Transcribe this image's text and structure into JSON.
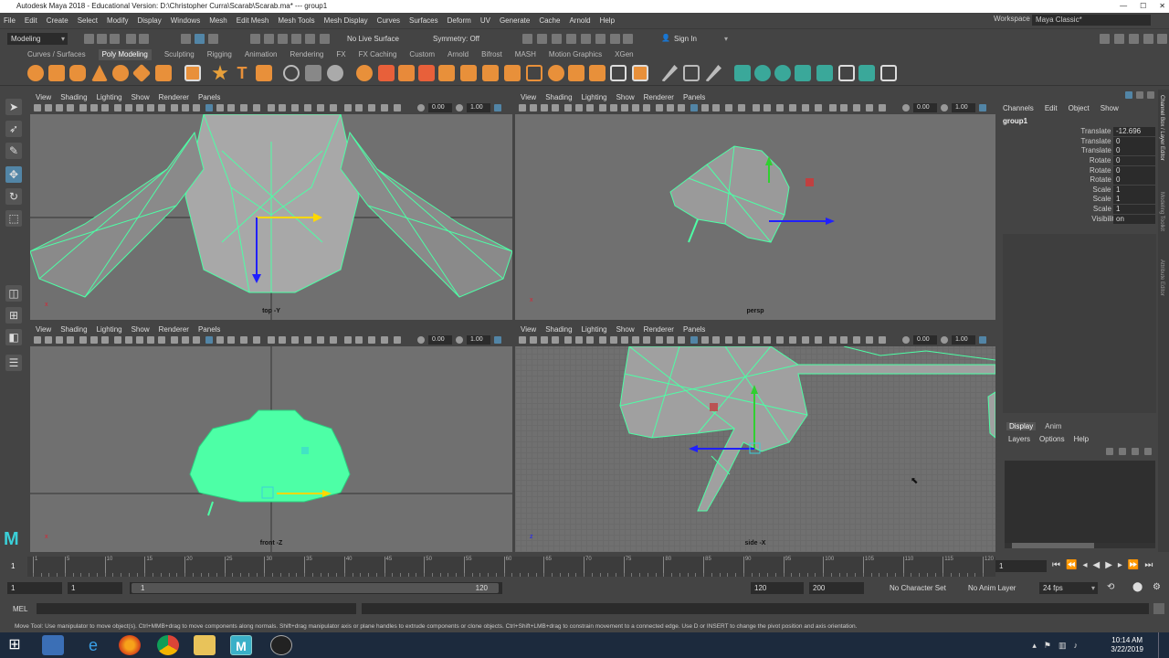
{
  "titlebar": {
    "title": "Autodesk Maya 2018 - Educational Version: D:\\Christopher Curra\\Scarab\\Scarab.ma*   ---   group1"
  },
  "menu": [
    "File",
    "Edit",
    "Create",
    "Select",
    "Modify",
    "Display",
    "Windows",
    "Mesh",
    "Edit Mesh",
    "Mesh Tools",
    "Mesh Display",
    "Curves",
    "Surfaces",
    "Deform",
    "UV",
    "Generate",
    "Cache",
    "Arnold",
    "Help"
  ],
  "workspace": {
    "label": "Workspace :",
    "value": "Maya Classic*"
  },
  "statusline": {
    "mode": "Modeling",
    "live_surface": "No Live Surface",
    "symmetry": "Symmetry: Off",
    "signin": "Sign In"
  },
  "shelf_tabs": [
    "Curves / Surfaces",
    "Poly Modeling",
    "Sculpting",
    "Rigging",
    "Animation",
    "Rendering",
    "FX",
    "FX Caching",
    "Custom",
    "Arnold",
    "Bifrost",
    "MASH",
    "Motion Graphics",
    "XGen"
  ],
  "active_shelf": "Poly Modeling",
  "viewport_menu": [
    "View",
    "Shading",
    "Lighting",
    "Show",
    "Renderer",
    "Panels"
  ],
  "viewport_fields": {
    "near": "0.00",
    "far": "1.00"
  },
  "viewports": {
    "top": "top -Y",
    "persp": "persp",
    "front": "front -Z",
    "side": "side -X"
  },
  "channel_box": {
    "menu": [
      "Channels",
      "Edit",
      "Object",
      "Show"
    ],
    "object": "group1",
    "channels": [
      {
        "label": "Translate X",
        "value": "-12.696"
      },
      {
        "label": "Translate Y",
        "value": "0"
      },
      {
        "label": "Translate Z",
        "value": "0"
      },
      {
        "label": "Rotate X",
        "value": "0"
      },
      {
        "label": "Rotate Y",
        "value": "0"
      },
      {
        "label": "Rotate Z",
        "value": "0"
      },
      {
        "label": "Scale X",
        "value": "1"
      },
      {
        "label": "Scale Y",
        "value": "1"
      },
      {
        "label": "Scale Z",
        "value": "1"
      },
      {
        "label": "Visibility",
        "value": "on"
      }
    ]
  },
  "side_tabs": [
    "Channel Box / Layer Editor",
    "Modeling Toolkit",
    "Attribute Editor"
  ],
  "layer_panel": {
    "tabs": [
      "Display",
      "Anim"
    ],
    "menu": [
      "Layers",
      "Options",
      "Help"
    ]
  },
  "timeline": {
    "ticks": [
      "1",
      "5",
      "10",
      "15",
      "20",
      "25",
      "30",
      "35",
      "40",
      "45",
      "50",
      "55",
      "60",
      "65",
      "70",
      "75",
      "80",
      "85",
      "90",
      "95",
      "100",
      "105",
      "110",
      "115",
      "120"
    ],
    "current": "1"
  },
  "range": {
    "start": "1",
    "playback_start": "1",
    "slider_start": "1",
    "slider_end": "120",
    "playback_end": "120",
    "end": "200",
    "character": "No Character Set",
    "anim_layer": "No Anim Layer",
    "fps": "24 fps"
  },
  "mel": {
    "label": "MEL"
  },
  "helpline": "Move Tool: Use manipulator to move object(s). Ctrl+MMB+drag to move components along normals. Shift+drag manipulator axis or plane handles to extrude components or clone objects. Ctrl+Shift+LMB+drag to constrain movement to a connected edge. Use D or INSERT to change the pivot position and axis orientation.",
  "clock": {
    "time": "10:14 AM",
    "date": "3/22/2019"
  },
  "colors": {
    "wire": "#4dffa6",
    "viewport_bg": "#707070",
    "panel": "#444444",
    "field": "#2b2b2b"
  }
}
